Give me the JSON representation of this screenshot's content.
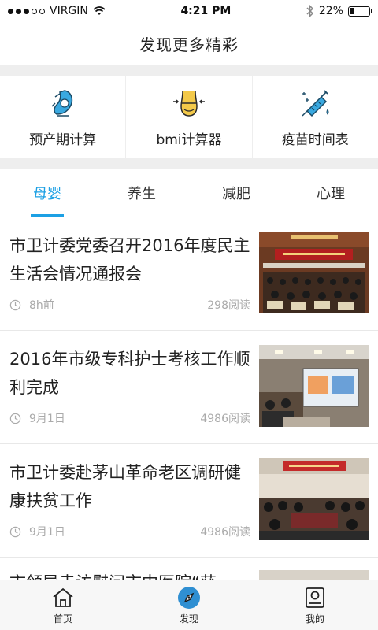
{
  "status": {
    "carrier": "VIRGIN",
    "signal_bars": 3,
    "signal_total": 5,
    "time": "4:21 PM",
    "battery_label": "22%",
    "battery_level": 0.22
  },
  "header": {
    "title": "发现更多精彩"
  },
  "tools": [
    {
      "label": "预产期计算",
      "icon": "pregnancy-icon"
    },
    {
      "label": "bmi计算器",
      "icon": "waist-measure-icon"
    },
    {
      "label": "疫苗时间表",
      "icon": "vaccine-syringe-icon"
    }
  ],
  "tabs": [
    {
      "label": "母婴",
      "active": true
    },
    {
      "label": "养生",
      "active": false
    },
    {
      "label": "减肥",
      "active": false
    },
    {
      "label": "心理",
      "active": false
    }
  ],
  "news": [
    {
      "title": "市卫计委党委召开2016年度民主生活会情况通报会",
      "time": "8h前",
      "reads": "298阅读"
    },
    {
      "title": "2016年市级专科护士考核工作顺利完成",
      "time": "9月1日",
      "reads": "4986阅读"
    },
    {
      "title": "市卫计委赴茅山革命老区调研健康扶贫工作",
      "time": "9月1日",
      "reads": "4986阅读"
    }
  ],
  "partial_news": {
    "title": "市领导走访慰问市中医院“获"
  },
  "bottom_nav": [
    {
      "label": "首页",
      "icon": "home-icon",
      "active": false
    },
    {
      "label": "发现",
      "icon": "compass-icon",
      "active": true
    },
    {
      "label": "我的",
      "icon": "profile-icon",
      "active": false
    }
  ],
  "colors": {
    "accent": "#1ca0e4",
    "icon_blue": "#3aa9e0",
    "icon_yellow": "#f3c94a"
  }
}
